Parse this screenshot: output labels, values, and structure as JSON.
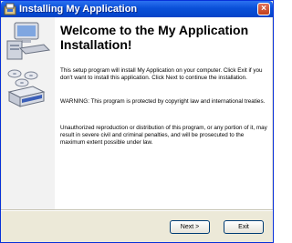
{
  "window": {
    "title": "Installing My Application",
    "close_label": "×"
  },
  "content": {
    "heading": "Welcome to the My Application Installation!",
    "paragraphs": [
      "This setup program will install My Application on your computer. Click Exit if you don't want to install this application. Click Next to continue the installation.",
      "WARNING: This program is protected by copyright law and international treaties.",
      "Unauthorized reproduction or distribution of this program, or any portion of it, may result in severe civil and criminal penalties, and will be prosecuted to the maximum extent possible under law."
    ]
  },
  "buttons": {
    "next_label": "Next >",
    "exit_label": "Exit"
  },
  "icons": {
    "app": "installer-icon",
    "side": "computer-install-illustration"
  },
  "colors": {
    "titlebar": "#0a50d8",
    "dialog_bg": "#ece9d8",
    "content_bg": "#ffffff",
    "button_border": "#003c74"
  }
}
